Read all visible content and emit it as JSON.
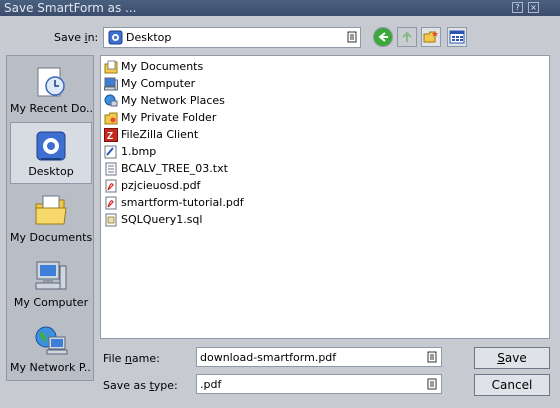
{
  "window": {
    "title": "Save SmartForm as ...",
    "help_glyph": "?",
    "close_glyph": "×"
  },
  "save_in": {
    "label": "Save in:",
    "value": "Desktop"
  },
  "places": [
    {
      "label": "My Recent Do...",
      "icon": "recent-documents-icon"
    },
    {
      "label": "Desktop",
      "icon": "desktop-icon",
      "selected": true
    },
    {
      "label": "My Documents",
      "icon": "my-documents-icon"
    },
    {
      "label": "My Computer",
      "icon": "my-computer-icon"
    },
    {
      "label": "My Network P...",
      "icon": "network-places-icon"
    }
  ],
  "files": [
    {
      "name": "My Documents",
      "icon": "folder-documents-icon"
    },
    {
      "name": "My Computer",
      "icon": "computer-icon"
    },
    {
      "name": "My Network Places",
      "icon": "network-icon"
    },
    {
      "name": "My Private Folder",
      "icon": "folder-icon"
    },
    {
      "name": "FileZilla Client",
      "icon": "filezilla-icon"
    },
    {
      "name": "1.bmp",
      "icon": "bitmap-icon"
    },
    {
      "name": "BCALV_TREE_03.txt",
      "icon": "text-file-icon"
    },
    {
      "name": "pzjcieuosd.pdf",
      "icon": "pdf-icon"
    },
    {
      "name": "smartform-tutorial.pdf",
      "icon": "pdf-icon"
    },
    {
      "name": "SQLQuery1.sql",
      "icon": "sql-file-icon"
    }
  ],
  "file_name": {
    "label": "File name:",
    "value": "download-smartform.pdf"
  },
  "save_as_type": {
    "label": "Save as type:",
    "value": ".pdf"
  },
  "buttons": {
    "save": "Save",
    "cancel": "Cancel"
  }
}
